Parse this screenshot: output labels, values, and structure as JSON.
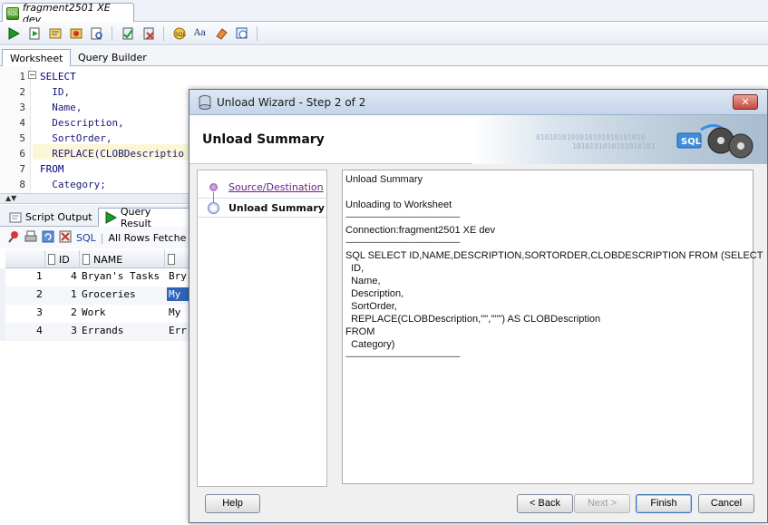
{
  "document_tab": {
    "label": "fragment2501 XE dev"
  },
  "editor_tabs": {
    "worksheet": "Worksheet",
    "query_builder": "Query Builder"
  },
  "editor": {
    "lines": [
      {
        "num": "1",
        "text": "SELECT"
      },
      {
        "num": "2",
        "text": "  ID,"
      },
      {
        "num": "3",
        "text": "  Name,"
      },
      {
        "num": "4",
        "text": "  Description,"
      },
      {
        "num": "5",
        "text": "  SortOrder,"
      },
      {
        "num": "6",
        "text": "  REPLACE(CLOBDescriptio"
      },
      {
        "num": "7",
        "text": "FROM"
      },
      {
        "num": "8",
        "text": "  Category;"
      }
    ]
  },
  "output_tabs": {
    "script_output": "Script Output",
    "query_result": "Query Result"
  },
  "output_toolbar": {
    "sql_label": "SQL",
    "status": "All Rows Fetche"
  },
  "grid": {
    "headers": {
      "id": "ID",
      "name": "NAME"
    },
    "rows": [
      {
        "rownum": "1",
        "id": "4",
        "name": "Bryan's Tasks",
        "desc": "Bry"
      },
      {
        "rownum": "2",
        "id": "1",
        "name": "Groceries",
        "desc": "My"
      },
      {
        "rownum": "3",
        "id": "2",
        "name": "Work",
        "desc": "My"
      },
      {
        "rownum": "4",
        "id": "3",
        "name": "Errands",
        "desc": "Err"
      }
    ]
  },
  "dialog": {
    "title": "Unload Wizard - Step 2 of 2",
    "banner_title": "Unload Summary",
    "banner_sql": "SQL",
    "nav": {
      "source": "Source/Destination",
      "summary": "Unload Summary"
    },
    "summary_lines": [
      "Unload Summary",
      "",
      "Unloading to Worksheet",
      "---------------------------------------------------------------",
      "Connection:fragment2501 XE dev",
      "---------------------------------------------------------------",
      "SQL SELECT ID,NAME,DESCRIPTION,SORTORDER,CLOBDESCRIPTION FROM (SELECT",
      "  ID,",
      "  Name,",
      "  Description,",
      "  SortOrder,",
      "  REPLACE(CLOBDescription,'\"','\"\"') AS CLOBDescription",
      "FROM",
      "  Category)",
      "---------------------------------------------------------------"
    ],
    "buttons": {
      "help": "Help",
      "back": "< Back",
      "next": "Next >",
      "finish": "Finish",
      "cancel": "Cancel"
    }
  },
  "colors": {
    "accent": "#3a6fb3",
    "title_bar": "#c4d4ea",
    "visited_link": "#6a1f8a"
  }
}
